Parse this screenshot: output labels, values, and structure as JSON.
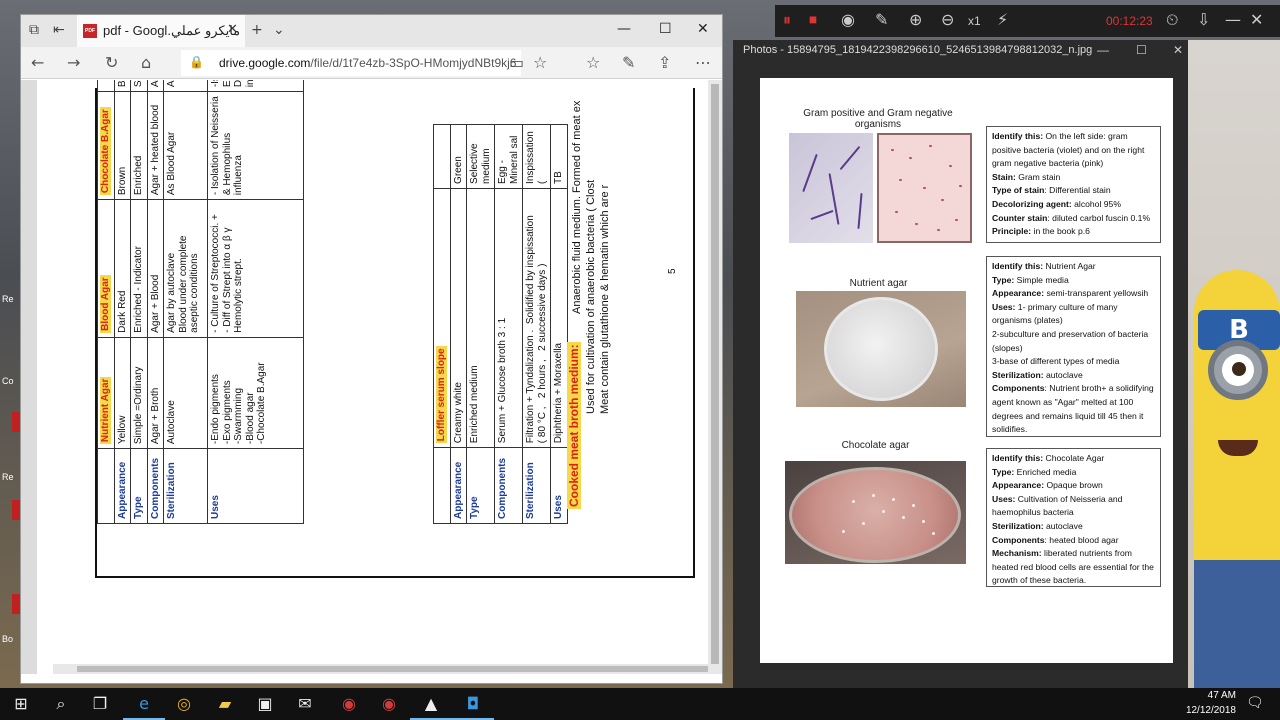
{
  "desktop": {
    "left_labels": [
      "Re",
      "Co",
      "Re",
      "Bo"
    ]
  },
  "edge": {
    "tab_title": "pdf - Googl.مايكرو عملي",
    "address": "drive.google.com/file/d/1t7e4zb-3SpO-HMomjydNBt9kj6",
    "address_domain": "drive.google.com",
    "address_path": "/file/d/1t7e4zb-3SpO-HMomjydNBt9kj6"
  },
  "pdf": {
    "page_number": "5",
    "table1": {
      "row_headers": [
        "Appearance",
        "Type",
        "Components",
        "Sterilization",
        "Uses"
      ],
      "columns": [
        {
          "title": "Nutrient Agar",
          "cells": [
            "Yellow",
            "Simple =Ordinary",
            "Agar + Broth",
            "Autoclave",
            "-Endo pigments\n-Exo pigments\n-Swarmming\n-Blood agar\n-Chocolate B.Agar"
          ]
        },
        {
          "title": "Blood Agar",
          "cells": [
            "Dark Red",
            "Enriched - Indicator",
            "Agar + Blood",
            "Agar by autoclave\nBlood under complete\naseptic conditions",
            "- Culture of Streptococci. +\n- Diff of Strept into α β γ\nHemolytic strept."
          ]
        },
        {
          "title": "Chocolate B.Agar",
          "cells": [
            "Brown",
            "Enriched",
            "Agar + heated blood",
            "As Blood Agar",
            "- Isolation of Neisseria\n& Hemophilus\ninfluenza"
          ]
        },
        {
          "title": "",
          "cells": [
            "Bri",
            "Sel",
            "Ag",
            "Au",
            "-Is\nEn\nDi\nint"
          ]
        }
      ]
    },
    "table2": {
      "row_headers": [
        "Appearance",
        "Type",
        "Components",
        "Sterilization",
        "Uses"
      ],
      "columns": [
        {
          "title": "Loffler serum slope",
          "cells": [
            "Creamy white",
            "Enriched medium",
            "Serum + Glucose broth    3 : 1",
            "Filtration + Tyndalization .  Solidified by inspissation\n( 80 °C ,   2 hours ,   2 successive days )",
            "Diphtheria  +  Moraxella"
          ]
        },
        {
          "title": "",
          "cells": [
            "Green",
            "Selective medium",
            "Egg - Mineral sal",
            "Inspissation   (",
            "TB"
          ]
        }
      ]
    },
    "cooked_title": "Cooked meat broth medium:",
    "cooked_lines": [
      "Anaerobic fluid medium.       Formed of meat ex",
      "Used for cultivation of anaerobic bacteria  ( Clost",
      "Meat contain glutathione &  hematin which are r"
    ]
  },
  "photos": {
    "title": "Photos - 15894795_1819422398296610_5246513984798812032_n.jpg",
    "section1": {
      "caption": "Gram positive and Gram negative\norganisms",
      "lines": [
        {
          "k": "Identify this:",
          "v": " On the left side: gram positive bacteria (violet) and on the right gram negative bacteria (pink)"
        },
        {
          "k": "Stain:",
          "v": " Gram stain"
        },
        {
          "k": "Type of stain",
          "v": ": Differential stain"
        },
        {
          "k": "Decolorizing agent:",
          "v": " alcohol 95%"
        },
        {
          "k": "Counter stain",
          "v": ": diluted carbol fuscin 0.1%"
        },
        {
          "k": "Principle:",
          "v": " in the book p.6"
        }
      ]
    },
    "section2": {
      "caption": "Nutrient agar",
      "lines": [
        {
          "k": "Identify this:",
          "v": " Nutrient Agar"
        },
        {
          "k": "Type:",
          "v": " Simple media"
        },
        {
          "k": "Appearance:",
          "v": " semi-transparent yellowsih"
        },
        {
          "k": "Uses:",
          "v": " 1- primary culture of many organisms (plates)"
        },
        {
          "k": "",
          "v": "2-subculture and preservation of bacteria (slopes)"
        },
        {
          "k": "",
          "v": "3-base of different types of media"
        },
        {
          "k": "Sterilization:",
          "v": " autoclave"
        },
        {
          "k": "Components",
          "v": ": Nutrient broth+ a solidifying agent known as \"Agar\" melted at 100 degrees and remains liquid till 45 then it solidifies."
        }
      ]
    },
    "section3": {
      "caption": "Chocolate agar",
      "lines": [
        {
          "k": "Identify this:",
          "v": " Chocolate Agar"
        },
        {
          "k": "Type:",
          "v": " Enriched media"
        },
        {
          "k": "Appearance:",
          "v": " Opaque brown"
        },
        {
          "k": "Uses:",
          "v": " Cultivation of Neisseria and haemophilus  bacteria"
        },
        {
          "k": "Sterilization:",
          "v": " autoclave"
        },
        {
          "k": "Components",
          "v": ": heated blood agar"
        },
        {
          "k": "Mechanism:",
          "v": " liberated nutrients from heated red blood cells are essential for the growth of these bacteria."
        }
      ]
    }
  },
  "recorder": {
    "zoom": "x1",
    "time": "00:12:23"
  },
  "minion": {
    "sign": "B"
  },
  "taskbar": {
    "time": "47 AM",
    "date": "12/12/2018"
  }
}
